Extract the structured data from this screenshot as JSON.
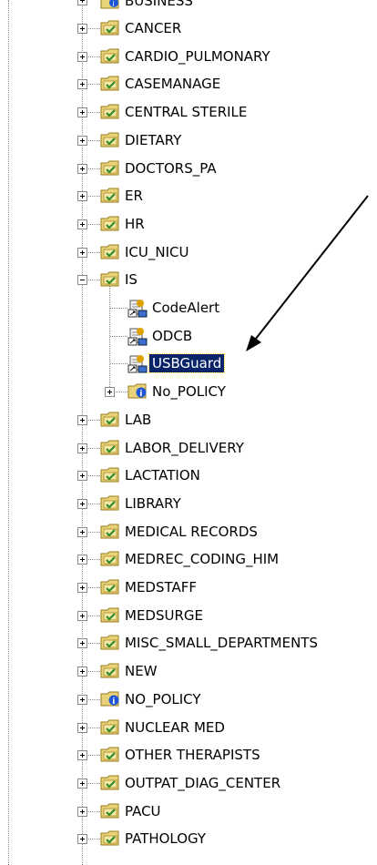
{
  "tree": {
    "top_partial_label": "BUSINESS",
    "items": [
      {
        "label": "CANCER",
        "type": "folder",
        "expander": "plus"
      },
      {
        "label": "CARDIO_PULMONARY",
        "type": "folder",
        "expander": "plus"
      },
      {
        "label": "CASEMANAGE",
        "type": "folder",
        "expander": "plus"
      },
      {
        "label": "CENTRAL STERILE",
        "type": "folder",
        "expander": "plus"
      },
      {
        "label": "DIETARY",
        "type": "folder",
        "expander": "plus"
      },
      {
        "label": "DOCTORS_PA",
        "type": "folder",
        "expander": "plus"
      },
      {
        "label": "ER",
        "type": "folder",
        "expander": "plus"
      },
      {
        "label": "HR",
        "type": "folder",
        "expander": "plus"
      },
      {
        "label": "ICU_NICU",
        "type": "folder",
        "expander": "plus"
      },
      {
        "label": "IS",
        "type": "folder",
        "expander": "minus"
      },
      {
        "label": "CodeAlert",
        "type": "policy",
        "child": true
      },
      {
        "label": "ODCB",
        "type": "policy",
        "child": true
      },
      {
        "label": "USBGuard",
        "type": "policy",
        "child": true,
        "selected": true
      },
      {
        "label": "No_POLICY",
        "type": "nopolicy",
        "child": true,
        "expander": "plus"
      },
      {
        "label": "LAB",
        "type": "folder",
        "expander": "plus"
      },
      {
        "label": "LABOR_DELIVERY",
        "type": "folder",
        "expander": "plus"
      },
      {
        "label": "LACTATION",
        "type": "folder",
        "expander": "plus"
      },
      {
        "label": "LIBRARY",
        "type": "folder",
        "expander": "plus"
      },
      {
        "label": "MEDICAL RECORDS",
        "type": "folder",
        "expander": "plus"
      },
      {
        "label": "MEDREC_CODING_HIM",
        "type": "folder",
        "expander": "plus"
      },
      {
        "label": "MEDSTAFF",
        "type": "folder",
        "expander": "plus"
      },
      {
        "label": "MEDSURGE",
        "type": "folder",
        "expander": "plus"
      },
      {
        "label": "MISC_SMALL_DEPARTMENTS",
        "type": "folder",
        "expander": "plus"
      },
      {
        "label": "NEW",
        "type": "folder",
        "expander": "plus"
      },
      {
        "label": "NO_POLICY",
        "type": "nopolicy",
        "expander": "plus"
      },
      {
        "label": "NUCLEAR MED",
        "type": "folder",
        "expander": "plus"
      },
      {
        "label": "OTHER THERAPISTS",
        "type": "folder",
        "expander": "plus"
      },
      {
        "label": "OUTPAT_DIAG_CENTER",
        "type": "folder",
        "expander": "plus"
      },
      {
        "label": "PACU",
        "type": "folder",
        "expander": "plus"
      },
      {
        "label": "PATHOLOGY",
        "type": "folder",
        "expander": "plus"
      }
    ]
  },
  "colors": {
    "selection": "#0a246a",
    "folder_fill": "#e8d27a",
    "folder_dark": "#9a7b1a",
    "check_green": "#2e8b2e",
    "info_blue": "#1e56d8",
    "arrow": "#000000"
  }
}
